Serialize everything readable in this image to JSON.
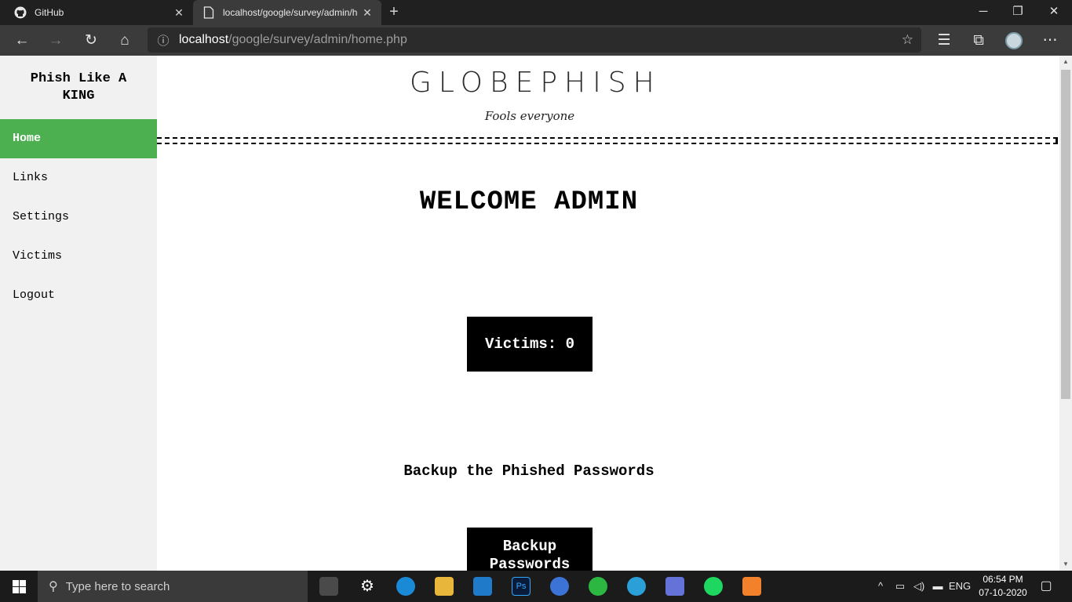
{
  "browser": {
    "tabs": [
      {
        "label": "GitHub",
        "icon": "github-icon",
        "active": false
      },
      {
        "label": "localhost/google/survey/admin/home.php",
        "icon": "page-icon",
        "active": true
      }
    ],
    "url_host": "localhost",
    "url_path": "/google/survey/admin/home.php"
  },
  "sidebar": {
    "brand": "Phish Like A KING",
    "items": [
      {
        "label": "Home",
        "active": true
      },
      {
        "label": "Links",
        "active": false
      },
      {
        "label": "Settings",
        "active": false
      },
      {
        "label": "Victims",
        "active": false
      },
      {
        "label": "Logout",
        "active": false
      }
    ]
  },
  "main": {
    "logo_text": "GLOBEPHISH",
    "logo_tagline": "Fools everyone",
    "welcome": "WELCOME ADMIN",
    "victims_text": "Victims: 0",
    "backup_label": "Backup the Phished Passwords",
    "backup_button": "Backup Passwords"
  },
  "taskbar": {
    "search_placeholder": "Type here to search",
    "language": "ENG",
    "time": "06:54 PM",
    "date": "07-10-2020",
    "apps": [
      "calculator-icon",
      "settings-gear-icon",
      "edge-icon",
      "file-explorer-icon",
      "vscode-icon",
      "photoshop-icon",
      "simplenote-icon",
      "whatsapp-icon",
      "telegram-icon",
      "discord-icon",
      "spotify-icon",
      "xampp-icon"
    ]
  },
  "colors": {
    "active_nav": "#4caf50",
    "browser_dark": "#202020",
    "toolbar": "#3b3b3b",
    "taskbar": "#1b1b1b"
  }
}
